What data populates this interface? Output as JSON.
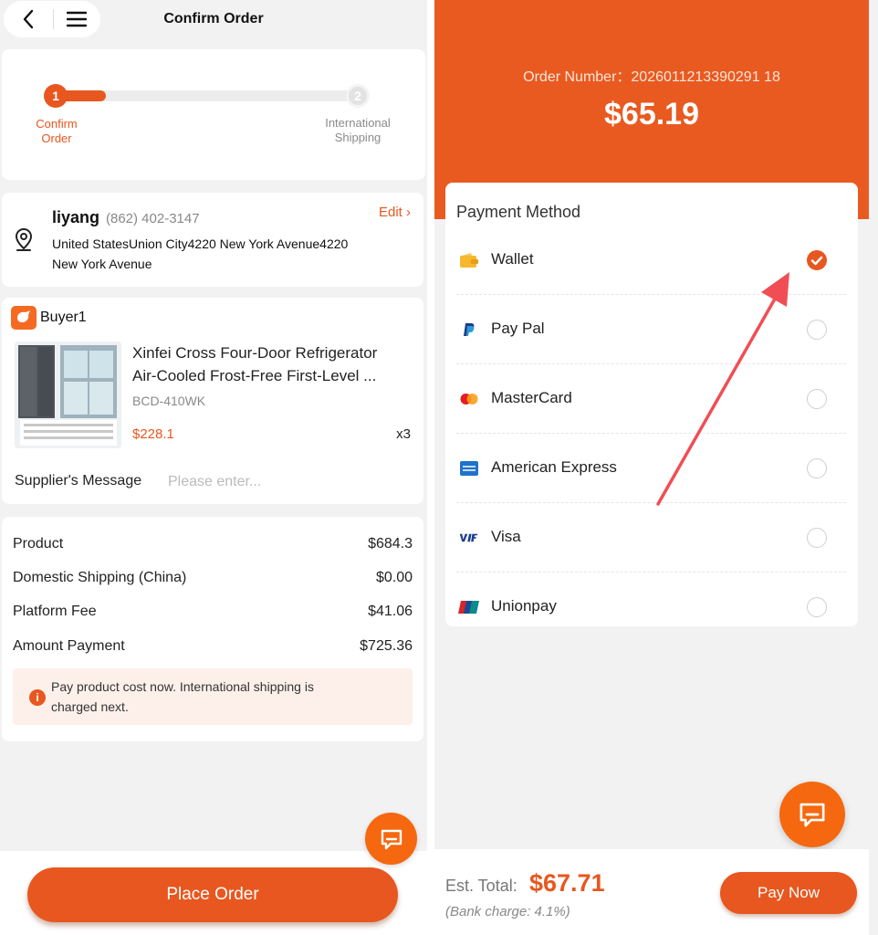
{
  "header": {
    "title": "Confirm Order"
  },
  "steps": [
    {
      "num": "1",
      "label": "Confirm Order",
      "active": true
    },
    {
      "num": "2",
      "label": "International Shipping",
      "active": false
    }
  ],
  "address": {
    "name": "liyang",
    "phone": "(862) 402-3147",
    "edit_label": "Edit",
    "line1": "United StatesUnion City4220 New York Avenue4220",
    "line2": "New York Avenue"
  },
  "shop": {
    "badge": "1688",
    "name": "Buyer1"
  },
  "product": {
    "title_line1": "Xinfei Cross Four-Door Refrigerator",
    "title_line2": "Air-Cooled Frost-Free First-Level ...",
    "sku": "BCD-410WK",
    "price": "$228.1",
    "qty": "x3"
  },
  "message": {
    "label": "Supplier's Message",
    "placeholder": "Please enter..."
  },
  "summary": {
    "rows": [
      {
        "label": "Product",
        "value": "$684.3"
      },
      {
        "label": "Domestic Shipping (China)",
        "value": "$0.00"
      },
      {
        "label": "Platform Fee",
        "value": "$41.06"
      },
      {
        "label": "Amount Payment",
        "value": "$725.36"
      }
    ],
    "notice_line1": "Pay product cost now. International shipping is",
    "notice_line2": "charged next."
  },
  "place_order_label": "Place Order",
  "payment": {
    "order_number": "Order Number：2026011213390291 18",
    "amount": "$65.19",
    "title": "Payment Method",
    "methods": [
      {
        "label": "Wallet",
        "icon": "wallet-icon",
        "selected": true
      },
      {
        "label": "Pay Pal",
        "icon": "paypal-icon",
        "selected": false
      },
      {
        "label": "MasterCard",
        "icon": "mastercard-icon",
        "selected": false
      },
      {
        "label": "American Express",
        "icon": "amex-icon",
        "selected": false
      },
      {
        "label": "Visa",
        "icon": "visa-icon",
        "selected": false
      },
      {
        "label": "Unionpay",
        "icon": "unionpay-icon",
        "selected": false
      }
    ],
    "est_total_label": "Est. Total:",
    "est_total_value": "$67.71",
    "bank_charge": "(Bank charge: 4.1%)",
    "pay_now_label": "Pay Now"
  },
  "colors": {
    "accent": "#e8571f",
    "header": "#e95a20",
    "background": "#f2f2f2"
  }
}
